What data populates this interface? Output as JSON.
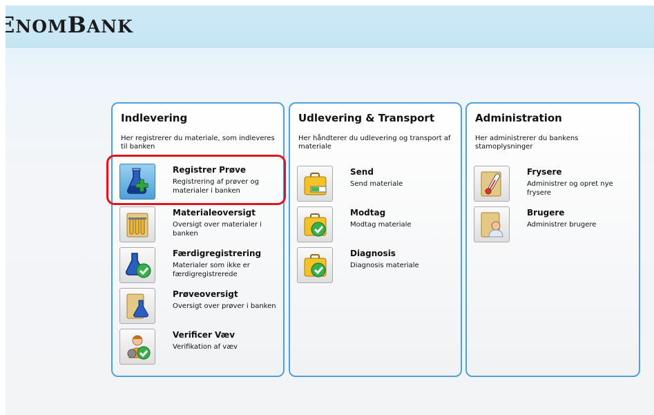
{
  "app": {
    "brand": "ENOMBANK"
  },
  "sections": [
    {
      "title": "Indlevering",
      "description": "Her registrerer du materiale, som indleveres til banken",
      "items": [
        {
          "title": "Registrer Prøve",
          "description": "Registrering af prøver og materialer i banken",
          "icon": "flask-add-icon",
          "selected": true
        },
        {
          "title": "Materialeoversigt",
          "description": "Oversigt over materialer i banken",
          "icon": "test-tubes-folder-icon"
        },
        {
          "title": "Færdigregistrering",
          "description": "Materialer som ikke er færdigregistrerede",
          "icon": "flask-check-icon"
        },
        {
          "title": "Prøveoversigt",
          "description": "Oversigt over prøver i banken",
          "icon": "folder-flask-icon"
        },
        {
          "title": "Verificer Væv",
          "description": "Verifikation af væv",
          "icon": "user-check-icon"
        }
      ]
    },
    {
      "title": "Udlevering & Transport",
      "description": "Her håndterer du udlevering og transport af materiale",
      "items": [
        {
          "title": "Send",
          "description": "Send materiale",
          "icon": "briefcase-send-icon"
        },
        {
          "title": "Modtag",
          "description": "Modtag materiale",
          "icon": "briefcase-check-icon"
        },
        {
          "title": "Diagnosis",
          "description": "Diagnosis materiale",
          "icon": "briefcase-check-icon"
        }
      ]
    },
    {
      "title": "Administration",
      "description": "Her administrerer du bankens stamoplysninger",
      "items": [
        {
          "title": "Frysere",
          "description": "Administrer og opret nye frysere",
          "icon": "thermometer-folder-icon"
        },
        {
          "title": "Brugere",
          "description": "Administrer brugere",
          "icon": "user-folder-icon"
        }
      ]
    }
  ],
  "colors": {
    "panel_border": "#4ea0dc",
    "highlight": "#e0141b",
    "banner": "#cde9f6"
  }
}
